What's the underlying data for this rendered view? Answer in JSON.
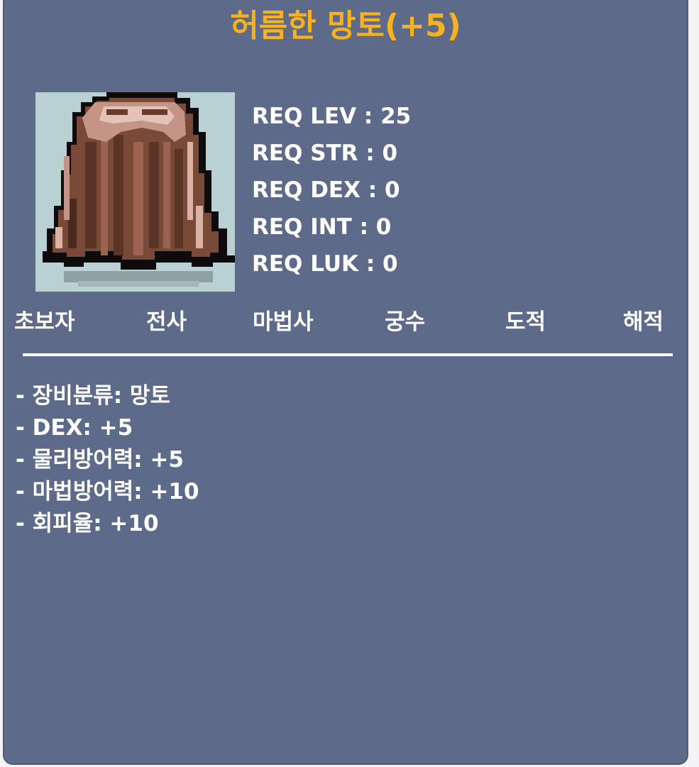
{
  "item": {
    "name": "허름한 망토(+5)",
    "icon": "cape-icon"
  },
  "requirements": [
    "REQ LEV : 25",
    "REQ STR : 0",
    "REQ DEX : 0",
    "REQ INT : 0",
    "REQ LUK : 0"
  ],
  "jobs": [
    "초보자",
    "전사",
    "마법사",
    "궁수",
    "도적",
    "해적"
  ],
  "stats": [
    "- 장비분류: 망토",
    "- DEX: +5",
    "- 물리방어력: +5",
    "- 마법방어력: +10",
    "- 회피율: +10"
  ],
  "colors": {
    "panel_bg": "#5d6a89",
    "title": "#f7b21e",
    "text": "#ffffff",
    "icon_bg": "#b9d1d3"
  }
}
